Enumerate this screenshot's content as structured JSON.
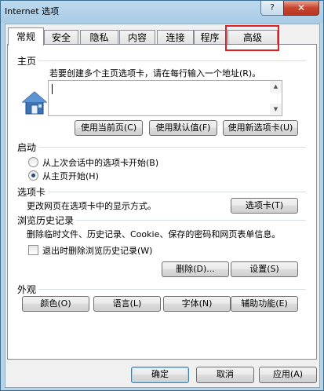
{
  "window": {
    "title": "Internet 选项",
    "help_label": "?",
    "close_label": "✕"
  },
  "tabs": [
    {
      "label": "常规"
    },
    {
      "label": "安全"
    },
    {
      "label": "隐私"
    },
    {
      "label": "内容"
    },
    {
      "label": "连接"
    },
    {
      "label": "程序"
    },
    {
      "label": "高级"
    }
  ],
  "home": {
    "group_label": "主页",
    "instruction": "若要创建多个主页选项卡，请在每行输入一个地址(R)。",
    "url_value": "",
    "use_current": "使用当前页(C)",
    "use_default": "使用默认值(F)",
    "use_new_tab": "使用新选项卡(U)"
  },
  "startup": {
    "group_label": "启动",
    "option_last_session": "从上次会话中的选项卡开始(B)",
    "option_home": "从主页开始(H)",
    "selected": "option_home"
  },
  "tabs_group": {
    "group_label": "选项卡",
    "description": "更改网页在选项卡中的显示方式。",
    "button": "选项卡(T)"
  },
  "history": {
    "group_label": "浏览历史记录",
    "description": "删除临时文件、历史记录、Cookie、保存的密码和网页表单信息。",
    "checkbox_label": "退出时删除浏览历史记录(W)",
    "checkbox_checked": false,
    "delete_button": "删除(D)...",
    "settings_button": "设置(S)"
  },
  "appearance": {
    "group_label": "外观",
    "colors": "颜色(O)",
    "languages": "语言(L)",
    "fonts": "字体(N)",
    "accessibility": "辅助功能(E)"
  },
  "footer": {
    "ok": "确定",
    "cancel": "取消",
    "apply": "应用(A)"
  },
  "colors": {
    "highlight": "#e02020",
    "accent": "#3c7fb1"
  }
}
